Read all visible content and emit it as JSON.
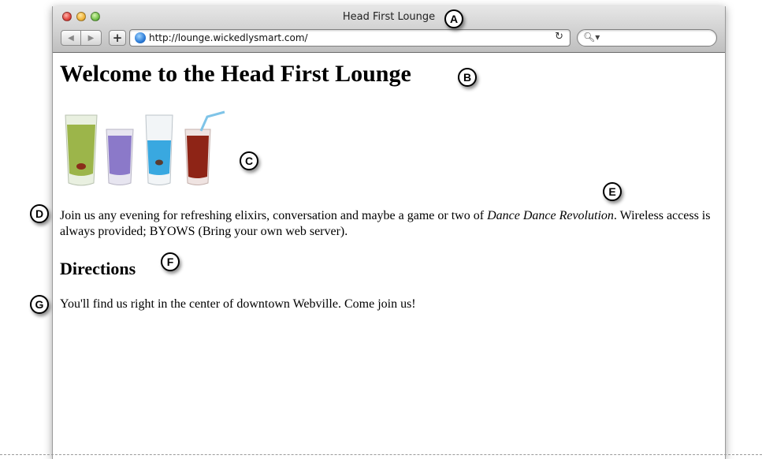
{
  "window": {
    "title": "Head First Lounge",
    "url": "http://lounge.wickedlysmart.com/",
    "search_placeholder": ""
  },
  "page": {
    "heading": "Welcome to the Head First Lounge",
    "intro_text": "Join us any evening for refreshing elixirs, conversation and maybe a game or two of ",
    "intro_emphasis": "Dance Dance Revolution",
    "intro_tail": ". Wireless access is always provided; BYOWS (Bring your own web server).",
    "subheading": "Directions",
    "directions_text": "You'll find us right in the center of downtown Webville. Come join us!",
    "image_alt": "drinks"
  },
  "callouts": {
    "a": "A",
    "b": "B",
    "c": "C",
    "d": "D",
    "e": "E",
    "f": "F",
    "g": "G"
  },
  "icons": {
    "back": "back-arrow-icon",
    "forward": "forward-arrow-icon",
    "add": "add-bookmark-icon",
    "site": "globe-icon",
    "reload": "reload-icon",
    "search": "search-icon"
  }
}
